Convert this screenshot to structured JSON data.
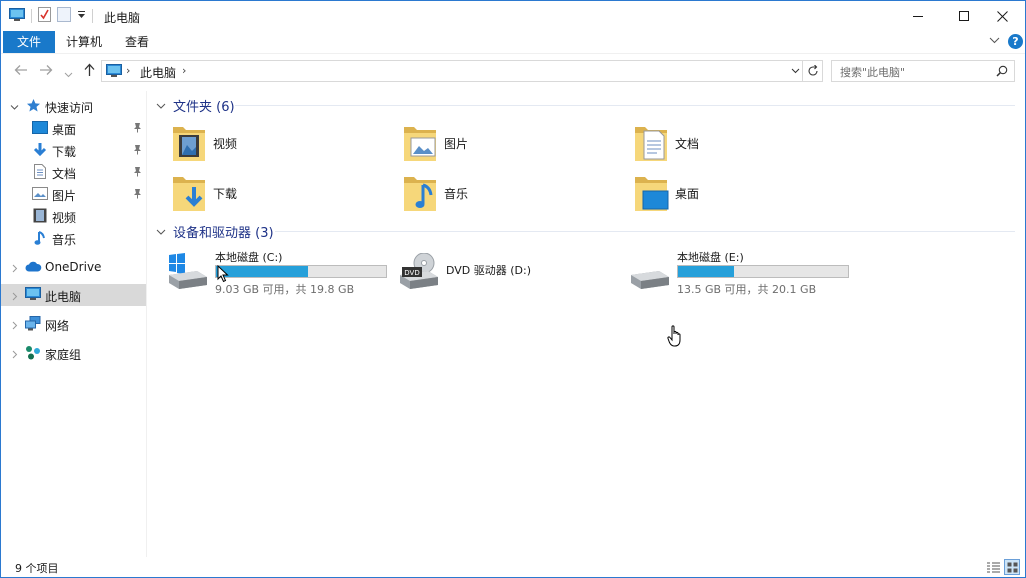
{
  "window": {
    "title": "此电脑"
  },
  "ribbon": {
    "tabs": [
      {
        "label": "文件"
      },
      {
        "label": "计算机"
      },
      {
        "label": "查看"
      }
    ],
    "help_label": "?"
  },
  "navbar": {
    "address_path": "此电脑",
    "search_placeholder": "搜索\"此电脑\""
  },
  "sidebar": {
    "quick_access": "快速访问",
    "quick_items": [
      {
        "label": "桌面"
      },
      {
        "label": "下载"
      },
      {
        "label": "文档"
      },
      {
        "label": "图片"
      },
      {
        "label": "视频"
      },
      {
        "label": "音乐"
      }
    ],
    "onedrive": "OneDrive",
    "this_pc": "此电脑",
    "network": "网络",
    "homegroup": "家庭组"
  },
  "content": {
    "folders_header": "文件夹 (6)",
    "folders": [
      {
        "label": "视频"
      },
      {
        "label": "图片"
      },
      {
        "label": "文档"
      },
      {
        "label": "下载"
      },
      {
        "label": "音乐"
      },
      {
        "label": "桌面"
      }
    ],
    "devices_header": "设备和驱动器 (3)",
    "drives": [
      {
        "name": "本地磁盘 (C:)",
        "free": "9.03 GB 可用，共 19.8 GB",
        "used_fraction": 0.544
      },
      {
        "name": "DVD 驱动器 (D:)"
      },
      {
        "name": "本地磁盘 (E:)",
        "free": "13.5 GB 可用，共 20.1 GB",
        "used_fraction": 0.328
      }
    ]
  },
  "statusbar": {
    "item_count": "9 个项目"
  },
  "colors": {
    "accent": "#1979ca",
    "drive_bar": "#26a0da",
    "section_title": "#1e3287",
    "window_border": "#2b79d0"
  }
}
